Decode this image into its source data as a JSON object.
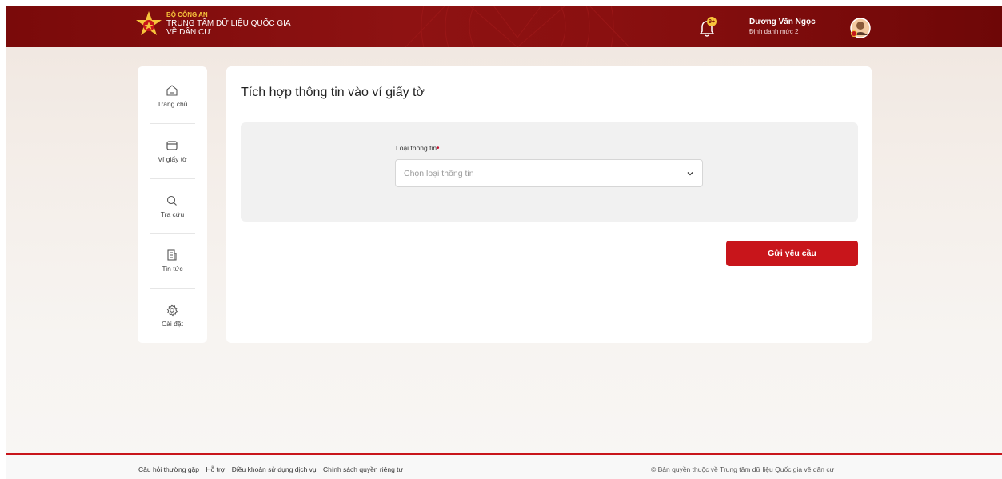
{
  "header": {
    "org_top": "BỘ CÔNG AN",
    "org_line1": "TRUNG TÂM DỮ LIỆU QUỐC GIA",
    "org_line2": "VỀ DÂN CƯ",
    "notification_count": "9+",
    "user_name": "Dương Văn Ngọc",
    "user_level": "Định danh mức 2",
    "brand_color": "#8e1212",
    "accent_color": "#f7c43b"
  },
  "sidebar": {
    "items": [
      {
        "label": "Trang chủ",
        "icon": "home-icon"
      },
      {
        "label": "Ví giấy tờ",
        "icon": "wallet-icon"
      },
      {
        "label": "Tra cứu",
        "icon": "search-icon"
      },
      {
        "label": "Tin tức",
        "icon": "news-icon"
      },
      {
        "label": "Cài đặt",
        "icon": "settings-icon"
      }
    ]
  },
  "main": {
    "title": "Tích hợp thông tin vào ví giấy tờ",
    "field_label": "Loại thông tin",
    "required_marker": "•",
    "select_placeholder": "Chọn loại thông tin",
    "submit_label": "Gửi yêu cầu",
    "button_color": "#c8151b"
  },
  "footer": {
    "links": [
      "Câu hỏi thường gặp",
      "Hỗ trợ",
      "Điều khoản sử dụng dịch vụ",
      "Chính sách quyền riêng tư"
    ],
    "copyright": "© Bản quyền thuộc về Trung tâm dữ liệu Quốc gia về dân cư"
  }
}
